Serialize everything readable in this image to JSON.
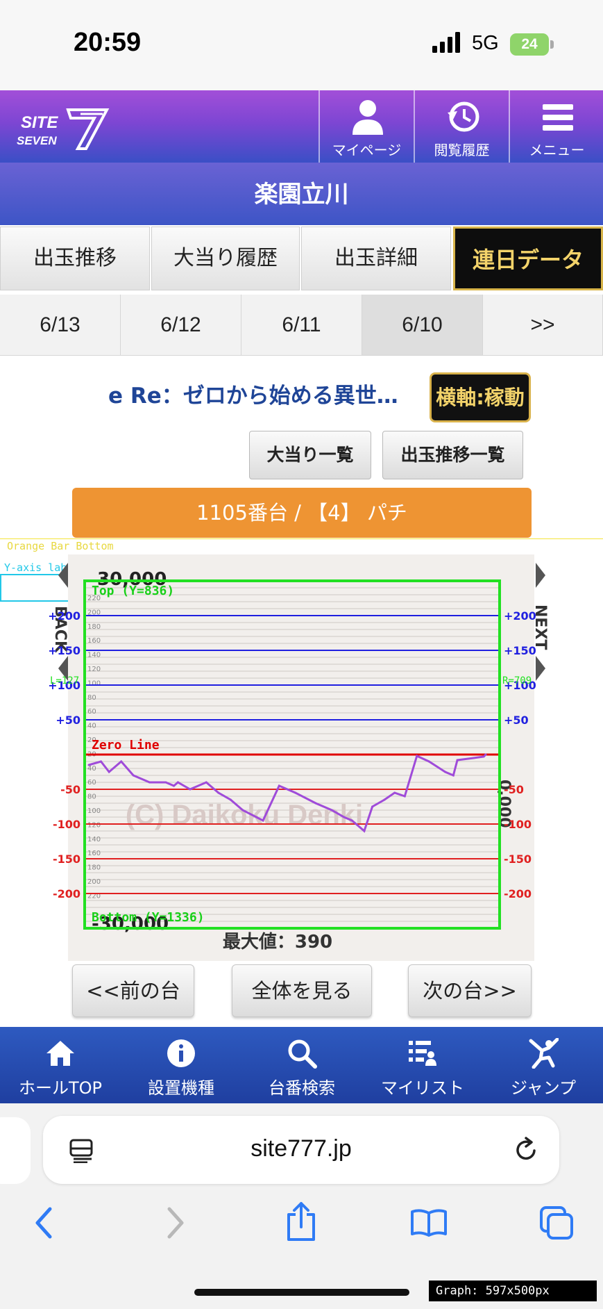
{
  "status": {
    "time": "20:59",
    "network": "5G",
    "battery": "24"
  },
  "header": {
    "logo_line1": "SITE",
    "logo_line2": "SEVEN",
    "buttons": [
      {
        "label": "マイページ",
        "icon": "person-icon"
      },
      {
        "label": "閲覧履歴",
        "icon": "history-icon"
      },
      {
        "label": "メニュー",
        "icon": "menu-icon"
      }
    ]
  },
  "store": {
    "name": "楽園立川"
  },
  "tabs": [
    {
      "label": "出玉推移"
    },
    {
      "label": "大当り履歴"
    },
    {
      "label": "出玉詳細"
    },
    {
      "label": "連日データ",
      "active": true
    }
  ],
  "dates": [
    "6/13",
    "6/12",
    "6/11",
    "6/10",
    ">>"
  ],
  "machine": {
    "title": "e Re：ゼロから始める異世…",
    "axis_button": "横軸:稼動"
  },
  "sub_buttons": {
    "jackpot_list": "大当り一覧",
    "payout_list": "出玉推移一覧"
  },
  "unit_bar": "1105番台 / 【4】 パチ",
  "chart_data": {
    "type": "line",
    "watermark": "(C) Daikoku Denki",
    "max_label": "最大値：390",
    "top_label": "30,000",
    "bottom_label": "-30,000",
    "left_side_text": "BACK",
    "right_side_text": "NEXT",
    "right_small_text": "0,000",
    "grid_small_labels": [
      "220",
      "200",
      "180",
      "160",
      "140",
      "120",
      "100",
      "80",
      "60",
      "40",
      "20",
      "20",
      "40",
      "60",
      "80",
      "100",
      "120",
      "140",
      "160",
      "180",
      "200",
      "220"
    ],
    "ylim": [
      -250,
      250
    ],
    "x": [
      0,
      30,
      50,
      80,
      110,
      150,
      190,
      210,
      220,
      250,
      290,
      320,
      350,
      380,
      430,
      470,
      510,
      560,
      600,
      630,
      650,
      680,
      700,
      730,
      755,
      780,
      810,
      840,
      880,
      900,
      910,
      950,
      975,
      980
    ],
    "y": [
      -15,
      -10,
      -25,
      -10,
      -30,
      -40,
      -40,
      -45,
      -40,
      -50,
      -40,
      -55,
      -65,
      -80,
      -95,
      -45,
      -55,
      -70,
      -80,
      -90,
      -95,
      -110,
      -75,
      -65,
      -55,
      -60,
      -2,
      -10,
      -25,
      -30,
      -8,
      -5,
      -3,
      0
    ],
    "colors": {
      "positive": "#2020e0",
      "negative": "#e02020",
      "line": "#9f4bd9",
      "zero": "#e00000"
    },
    "levels": {
      "positive": [
        "+200",
        "+150",
        "+100",
        "+50"
      ],
      "negative": [
        "-50",
        "-100",
        "-150",
        "-200"
      ]
    }
  },
  "debug": {
    "orange_bottom": "Orange Bar Bottom",
    "y_axis_labels": "Y-axis labels",
    "top": "Top (Y=836)",
    "zero": "Zero Line",
    "bottom": "Bottom (Y=1336)",
    "left_marker": "L=127",
    "right_marker": "R=709",
    "graph_size": "Graph: 597x500px"
  },
  "bottom_buttons": {
    "prev": "<<前の台",
    "all": "全体を見る",
    "next": "次の台>>"
  },
  "bottom_nav": [
    {
      "label": "ホールTOP",
      "icon": "home-icon"
    },
    {
      "label": "設置機種",
      "icon": "info-icon"
    },
    {
      "label": "台番検索",
      "icon": "search-icon"
    },
    {
      "label": "マイリスト",
      "icon": "list-icon"
    },
    {
      "label": "ジャンプ",
      "icon": "jump-icon"
    }
  ],
  "browser": {
    "url": "site777.jp"
  }
}
